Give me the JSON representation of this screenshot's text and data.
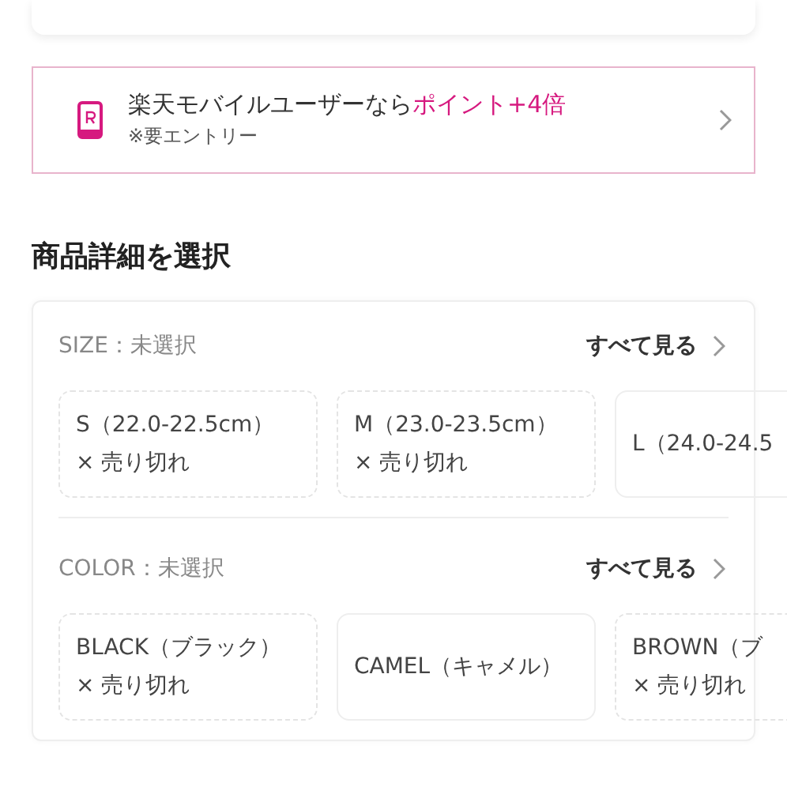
{
  "promo": {
    "text": "楽天モバイルユーザーなら",
    "highlight": "ポイント+4倍",
    "note": "※要エントリー"
  },
  "heading": "商品詳細を選択",
  "sections": [
    {
      "label": "SIZE：未選択",
      "see_all": "すべて見る",
      "options": [
        {
          "label": "S（22.0-22.5cm）",
          "sold_out": true,
          "note": "× 売り切れ"
        },
        {
          "label": "M（23.0-23.5cm）",
          "sold_out": true,
          "note": "× 売り切れ"
        },
        {
          "label": "L（24.0-24.5",
          "sold_out": false
        }
      ]
    },
    {
      "label": "COLOR：未選択",
      "see_all": "すべて見る",
      "options": [
        {
          "label": "BLACK（ブラック）",
          "sold_out": true,
          "note": "× 売り切れ"
        },
        {
          "label": "CAMEL（キャメル）",
          "sold_out": false
        },
        {
          "label": "BROWN（ブ",
          "sold_out": true,
          "note": "× 売り切れ"
        }
      ]
    }
  ]
}
